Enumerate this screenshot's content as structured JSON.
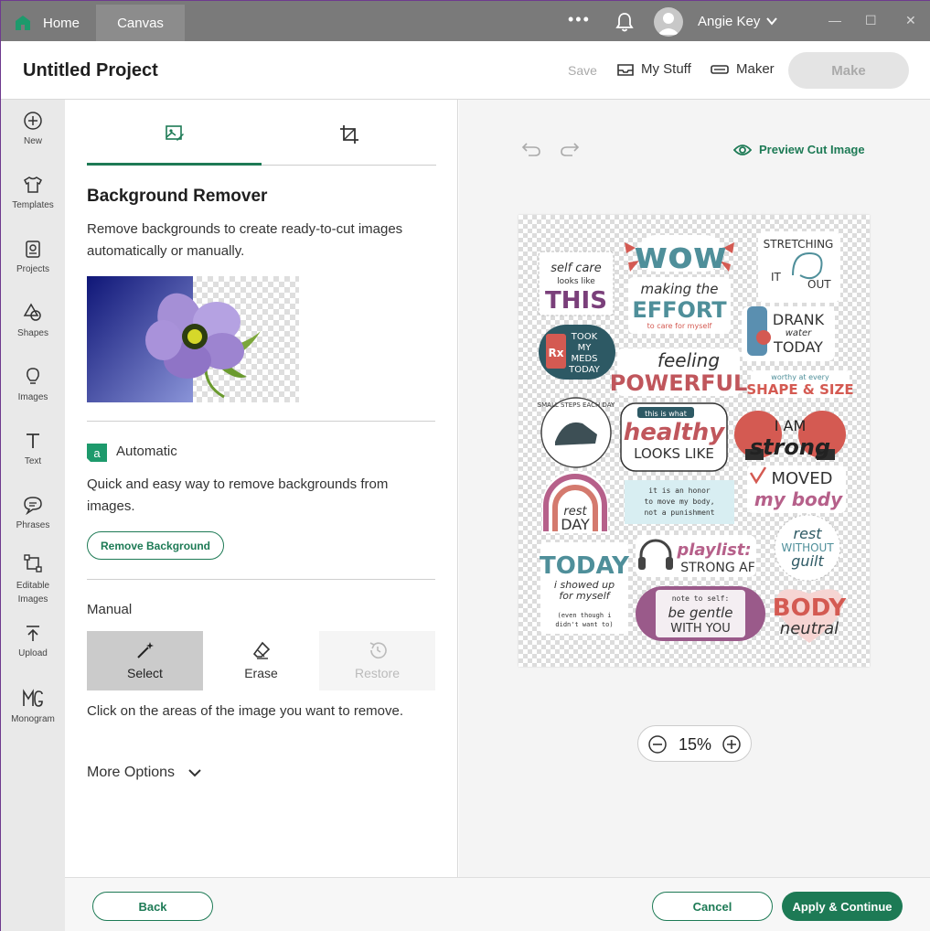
{
  "titlebar": {
    "tabs": [
      {
        "label": "Home"
      },
      {
        "label": "Canvas"
      }
    ],
    "more": "•••",
    "user": "Angie Key",
    "window": {
      "minimize": "—",
      "maximize": "☐",
      "close": "✕"
    }
  },
  "header": {
    "project_title": "Untitled Project",
    "save": "Save",
    "my_stuff": "My Stuff",
    "maker": "Maker",
    "make": "Make"
  },
  "rail": {
    "items": [
      {
        "label": "New"
      },
      {
        "label": "Templates"
      },
      {
        "label": "Projects"
      },
      {
        "label": "Shapes"
      },
      {
        "label": "Images"
      },
      {
        "label": "Text"
      },
      {
        "label": "Phrases"
      },
      {
        "label": "Editable Images"
      },
      {
        "label": "Upload"
      },
      {
        "label": "Monogram"
      }
    ]
  },
  "panel": {
    "title": "Background Remover",
    "description": "Remove backgrounds to create ready-to-cut images automatically or manually.",
    "automatic": {
      "badge": "a",
      "label": "Automatic",
      "description": "Quick and easy way to remove backgrounds from images.",
      "button": "Remove Background"
    },
    "manual": {
      "label": "Manual",
      "tools": [
        {
          "label": "Select"
        },
        {
          "label": "Erase"
        },
        {
          "label": "Restore"
        }
      ],
      "description": "Click on the areas of the image you want to remove.",
      "more_options": "More Options"
    }
  },
  "canvas": {
    "preview_cut": "Preview Cut Image",
    "zoom": "15%",
    "stickers": {
      "self_care": [
        "self care",
        "looks like",
        "THIS"
      ],
      "wow": "wow",
      "stretching": [
        "STRETCHING",
        "IT",
        "OUT"
      ],
      "effort": [
        "making the",
        "EFFORT",
        "to care for myself"
      ],
      "drank": [
        "DRANK",
        "water",
        "TODAY"
      ],
      "meds": [
        "Rx",
        "TOOK",
        "MY",
        "MEDS",
        "TODAY"
      ],
      "powerful": [
        "feeling",
        "POWERFUL"
      ],
      "shape": [
        "worthy at every",
        "SHAPE & SIZE"
      ],
      "small_steps": "SMALL STEPS EACH DAY",
      "healthy": [
        "this is what",
        "healthy",
        "LOOKS LIKE"
      ],
      "strong": [
        "I AM",
        "strong"
      ],
      "rest_day": [
        "rest",
        "DAY"
      ],
      "honor": [
        "it is an honor",
        "to move my body,",
        "not a punishment"
      ],
      "moved": [
        "MOVED",
        "my body"
      ],
      "today_showed": [
        "TODAY",
        "i showed up",
        "for myself",
        "(even though i",
        "didn't want to)"
      ],
      "playlist": [
        "playlist:",
        "STRONG AF"
      ],
      "rest_guilt": [
        "rest",
        "WITHOUT",
        "guilt"
      ],
      "gentle": [
        "note to self:",
        "be gentle",
        "WITH YOU"
      ],
      "body_neutral": [
        "BODY",
        "neutral"
      ]
    }
  },
  "footer": {
    "back": "Back",
    "cancel": "Cancel",
    "apply": "Apply & Continue"
  },
  "colors": {
    "accent": "#1d7a55",
    "titlebar": "#7a7a7a",
    "rail": "#e9e9e9"
  }
}
